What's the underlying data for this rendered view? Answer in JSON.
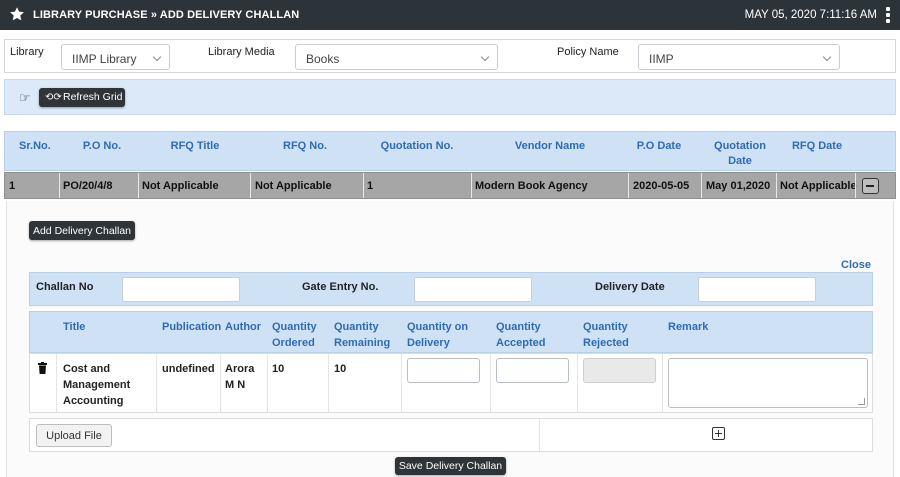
{
  "header": {
    "title": "LIBRARY PURCHASE » ADD DELIVERY CHALLAN",
    "datetime": "MAY 05, 2020  7:11:16 AM"
  },
  "filters": {
    "library_label": "Library",
    "library_value": "IIMP Library",
    "media_label": "Library Media",
    "media_value": "Books",
    "policy_label": "Policy Name",
    "policy_value": "IIMP"
  },
  "toolbar": {
    "refresh_label": "Refresh Grid"
  },
  "grid": {
    "columns": [
      "Sr.No.",
      "P.O No.",
      "RFQ Title",
      "RFQ No.",
      "Quotation No.",
      "Vendor Name",
      "P.O Date",
      "Quotation Date",
      "RFQ Date"
    ],
    "row": [
      "1",
      "PO/20/4/8",
      "Not Applicable",
      "Not Applicable",
      "1",
      "Modern Book Agency",
      "2020-05-05",
      "May 01,2020",
      "Not Applicable"
    ]
  },
  "detail": {
    "add_button": "Add Delivery Challan",
    "close_label": "Close",
    "challan_no_label": "Challan No",
    "gate_entry_label": "Gate Entry No.",
    "delivery_date_label": "Delivery Date",
    "item_columns": [
      "Title",
      "Publication",
      "Author",
      "Quantity Ordered",
      "Quantity Remaining",
      "Quantity on Delivery",
      "Quantity Accepted",
      "Quantity Rejected",
      "Remark"
    ],
    "item_row": {
      "title": "Cost and Management Accounting",
      "publication": "undefined",
      "author": "Arora M N",
      "qty_ordered": "10",
      "qty_remaining": "10"
    },
    "upload_label": "Upload File",
    "save_button": "Save Delivery Challan"
  },
  "colors": {
    "topbar": "#2d3439",
    "header_blue": "#cfe2f5",
    "link_blue": "#2f6bb3",
    "selected_row": "#a6a6a6"
  }
}
